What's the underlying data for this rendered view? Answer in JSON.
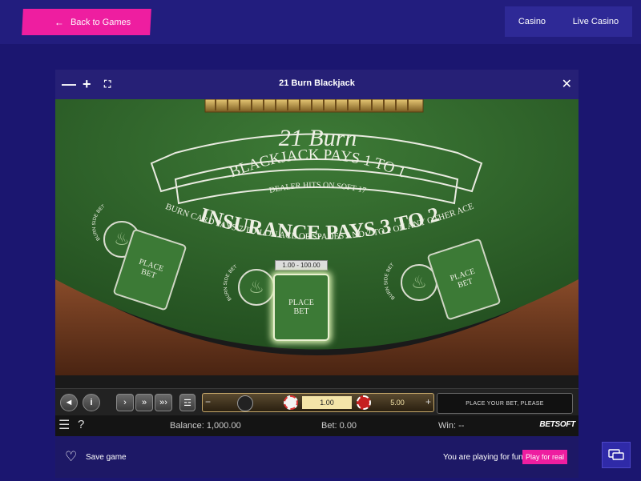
{
  "nav": {
    "back_label": "Back to Games",
    "links": [
      "Casino",
      "Live Casino"
    ]
  },
  "game": {
    "title": "21 Burn Blackjack",
    "table": {
      "logo": "21 Burn",
      "line1": "BLACKJACK PAYS 1 TO 1",
      "line2": "DEALER HITS ON SOFT 17",
      "line3": "INSURANCE PAYS 3 TO 2",
      "line4": "BURN CARD PAYS 7 TO 1 ON ACE OF SPADES AND 2 TO 1 ON ANY OTHER ACE",
      "side_bet_label": "BURN SIDE BET",
      "place_bet": "PLACE BET",
      "bet_limits": "1.00 - 100.00"
    },
    "controls": {
      "chip_value": "1.00",
      "total_value": "5.00",
      "message": "PLACE YOUR BET, PLEASE"
    },
    "status": {
      "balance_label": "Balance:",
      "balance_value": "1,000.00",
      "bet_label": "Bet:",
      "bet_value": "0.00",
      "win_label": "Win:",
      "win_value": "--",
      "brand": "BETSOFT"
    },
    "footer": {
      "save_label": "Save game",
      "fun_text": "You are playing for fun",
      "play_real_label": "Play for real"
    }
  },
  "colors": {
    "page_bg": "#1b1670",
    "accent_pink": "#ee1ea0",
    "felt_green": "#2f6a2a"
  },
  "icons": [
    "arrow-left-icon",
    "minus-icon",
    "plus-icon",
    "fullscreen-icon",
    "close-icon",
    "heart-icon",
    "chat-icon",
    "menu-icon",
    "help-icon",
    "flame-icon"
  ]
}
